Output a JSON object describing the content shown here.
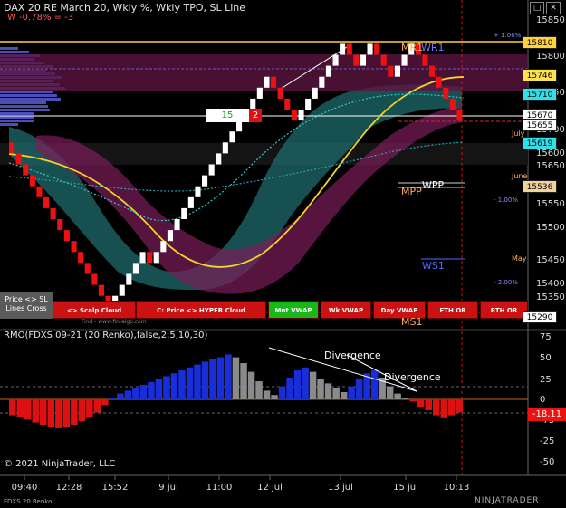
{
  "header": {
    "title": "DAX 20 RE March 20, Wkly %, Wkly TPO, SL Line",
    "change": "W -0.78% = -3"
  },
  "window_controls": {
    "maximize": "□",
    "close": "✕"
  },
  "left_box": {
    "label1": "Price <> SL",
    "label2": "Lines Cross"
  },
  "bottom_buttons": [
    {
      "label": "<> Scalp Cloud",
      "color": "#cc1111"
    },
    {
      "label": "C: Price <> HYPER Cloud",
      "color": "#cc1111"
    },
    {
      "label": "Mnt VWAP",
      "color": "#19b819"
    },
    {
      "label": "Wk VWAP",
      "color": "#cc1111"
    },
    {
      "label": "Day VWAP",
      "color": "#cc1111"
    },
    {
      "label": "ETH OR",
      "color": "#cc1111"
    },
    {
      "label": "RTH OR",
      "color": "#cc1111"
    }
  ],
  "small_credit": "Find - www.fin-algo.com",
  "level_labels": {
    "mr1": "MR1",
    "wr1": "WR1",
    "wpp": "WPP",
    "mpp": "MPP",
    "ws1": "WS1",
    "ms1": "MS1",
    "july": "July",
    "june": "June",
    "may": "May",
    "pct_plus1": "+ 1.00%",
    "pct_minus1": "- 1.00%",
    "pct_minus2": "- 2.00%"
  },
  "price_box": {
    "count": "15",
    "dir": "2"
  },
  "price_tags": [
    {
      "value": "15810",
      "color": "#ffd23c"
    },
    {
      "value": "15746",
      "color": "#ffe34a"
    },
    {
      "value": "15710",
      "color": "#2fe0e8"
    },
    {
      "value": "15670",
      "color": "#ffffff"
    },
    {
      "value": "15655",
      "color": "#ffffff"
    },
    {
      "value": "15619",
      "color": "#2fe0e8"
    },
    {
      "value": "15536",
      "color": "#f2d29b"
    },
    {
      "value": "15290",
      "color": "#ffffff"
    }
  ],
  "price_axis": {
    "ticks": [
      "15850",
      "15800",
      "15750",
      "15700",
      "15650",
      "15600",
      "15550",
      "15500",
      "15450",
      "15400",
      "15350"
    ]
  },
  "x_labels": [
    "09:40",
    "12:28",
    "15:52",
    "9 jul",
    "11:00",
    "12 jul",
    "13 jul",
    "15 jul",
    "10:13"
  ],
  "indicator": {
    "title": "RMO(FDXS 09-21 (20 Renko),false,2,5,10,30)",
    "ticks": [
      "75",
      "50",
      "25",
      "0",
      "-25",
      "-50",
      "-75"
    ],
    "current_value": "-18,11",
    "divergence1": "Divergence",
    "divergence2": "Divergence"
  },
  "footer": {
    "copyright": "© 2021 NinjaTrader, LLC",
    "instrument": "FDXS 20 Renko",
    "brand": "NINJATRADER"
  },
  "chart_data": {
    "type": "renko",
    "title": "DAX 20 RE March 20, Wkly %, Wkly TPO, SL Line",
    "y_range": [
      15270,
      15870
    ],
    "bricks": [
      15590,
      15570,
      15550,
      15530,
      15510,
      15490,
      15470,
      15450,
      15430,
      15410,
      15390,
      15370,
      15350,
      15330,
      15310,
      15330,
      15350,
      15370,
      15390,
      15410,
      15390,
      15410,
      15430,
      15450,
      15470,
      15490,
      15510,
      15530,
      15550,
      15570,
      15590,
      15610,
      15630,
      15650,
      15670,
      15690,
      15710,
      15730,
      15710,
      15690,
      15670,
      15650,
      15670,
      15690,
      15710,
      15730,
      15750,
      15770,
      15790,
      15770,
      15750,
      15770,
      15790,
      15770,
      15750,
      15730,
      15750,
      15770,
      15790,
      15770,
      15750,
      15730,
      15710,
      15690,
      15670,
      15650
    ],
    "levels": {
      "MR1": 15810,
      "WR1": 15810,
      "WPP": 15540,
      "MPP": 15525,
      "WS1": 15400,
      "MS1": 15280
    },
    "rmo": {
      "y_range": [
        -75,
        75
      ],
      "values": [
        -22,
        -25,
        -28,
        -32,
        -35,
        -38,
        -40,
        -38,
        -35,
        -30,
        -25,
        -18,
        -8,
        2,
        8,
        12,
        16,
        20,
        24,
        28,
        32,
        36,
        40,
        44,
        48,
        52,
        56,
        58,
        62,
        58,
        50,
        38,
        25,
        12,
        6,
        18,
        30,
        40,
        44,
        38,
        28,
        22,
        15,
        10,
        18,
        28,
        36,
        40,
        30,
        18,
        8,
        2,
        -3,
        -10,
        -15,
        -22,
        -26,
        -22,
        -18
      ]
    }
  }
}
